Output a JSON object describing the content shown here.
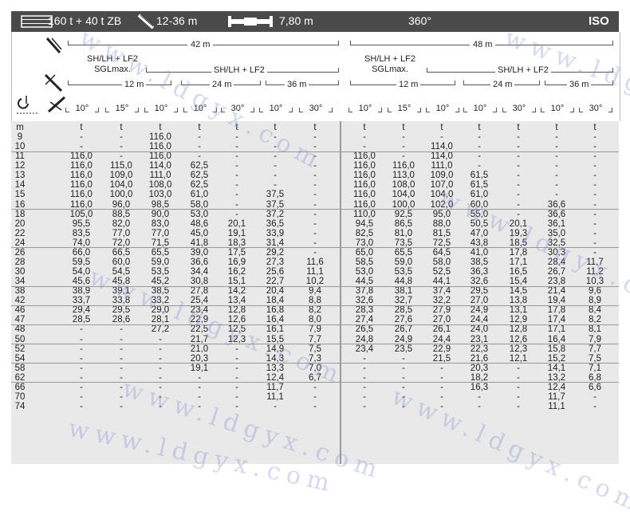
{
  "header": {
    "config": "160 t + 40 t ZB",
    "jib_range": "12-36 m",
    "outrigger": "7,80 m",
    "slew": "360°",
    "standard": "ISO"
  },
  "boom_group_left": {
    "boom": "42 m",
    "mode_a": "SH/LH + LF2",
    "mode_a_sub": "SGLmax.",
    "mode_b": "SH/LH + LF2",
    "jib_lengths": [
      "12 m",
      "24 m",
      "36 m"
    ],
    "offsets": [
      "10°",
      "15°",
      "10°",
      "10°",
      "30°",
      "10°",
      "30°"
    ]
  },
  "boom_group_right": {
    "boom": "48 m",
    "mode_a": "SH/LH + LF2",
    "mode_a_sub": "SGLmax.",
    "mode_b": "SH/LH + LF2",
    "jib_lengths": [
      "12 m",
      "24 m",
      "36 m"
    ],
    "offsets": [
      "10°",
      "15°",
      "10°",
      "10°",
      "30°",
      "10°",
      "30°"
    ]
  },
  "units": [
    "m",
    "t",
    "t",
    "t",
    "t",
    "t",
    "t",
    "t",
    "t",
    "t",
    "t",
    "t",
    "t",
    "t",
    "t"
  ],
  "rows": [
    [
      "9",
      "-",
      "-",
      "116,0",
      "-",
      "-",
      "-",
      "-",
      "-",
      "-",
      "-",
      "-",
      "-",
      "-",
      "-"
    ],
    [
      "10",
      "-",
      "-",
      "116,0",
      "-",
      "-",
      "-",
      "-",
      "-",
      "-",
      "114,0",
      "-",
      "-",
      "-",
      "-"
    ],
    [
      "11",
      "116,0",
      "-",
      "116,0",
      "-",
      "-",
      "-",
      "-",
      "116,0",
      "-",
      "114,0",
      "-",
      "-",
      "-",
      "-"
    ],
    [
      "12",
      "116,0",
      "115,0",
      "114,0",
      "62,5",
      "-",
      "-",
      "-",
      "116,0",
      "116,0",
      "111,0",
      "-",
      "-",
      "-",
      "-"
    ],
    [
      "13",
      "116,0",
      "109,0",
      "111,0",
      "62,5",
      "-",
      "-",
      "-",
      "116,0",
      "113,0",
      "109,0",
      "61,5",
      "-",
      "-",
      "-"
    ],
    [
      "14",
      "116,0",
      "104,0",
      "108,0",
      "62,5",
      "-",
      "-",
      "-",
      "116,0",
      "108,0",
      "107,0",
      "61,5",
      "-",
      "-",
      "-"
    ],
    [
      "15",
      "116,0",
      "100,0",
      "103,0",
      "61,0",
      "-",
      "37,5",
      "-",
      "116,0",
      "104,0",
      "104,0",
      "61,0",
      "-",
      "-",
      "-"
    ],
    [
      "16",
      "116,0",
      "96,0",
      "98,5",
      "58,0",
      "-",
      "37,5",
      "-",
      "116,0",
      "100,0",
      "102,0",
      "60,0",
      "-",
      "36,6",
      "-"
    ],
    [
      "18",
      "105,0",
      "88,5",
      "90,0",
      "53,0",
      "-",
      "37,2",
      "-",
      "110,0",
      "92,5",
      "95,0",
      "55,0",
      "-",
      "36,6",
      "-"
    ],
    [
      "20",
      "95,5",
      "82,0",
      "83,0",
      "48,6",
      "20,1",
      "36,5",
      "-",
      "94,5",
      "86,5",
      "88,0",
      "50,5",
      "20,1",
      "36,1",
      "-"
    ],
    [
      "22",
      "83,5",
      "77,0",
      "77,0",
      "45,0",
      "19,1",
      "33,9",
      "-",
      "82,5",
      "81,0",
      "81,5",
      "47,0",
      "19,3",
      "35,0",
      "-"
    ],
    [
      "24",
      "74,0",
      "72,0",
      "71,5",
      "41,8",
      "18,3",
      "31,4",
      "-",
      "73,0",
      "73,5",
      "72,5",
      "43,8",
      "18,5",
      "32,5",
      "-"
    ],
    [
      "26",
      "66,0",
      "66,5",
      "65,5",
      "39,0",
      "17,5",
      "29,2",
      "-",
      "65,0",
      "65,5",
      "64,5",
      "41,0",
      "17,8",
      "30,3",
      "-"
    ],
    [
      "28",
      "59,5",
      "60,0",
      "59,0",
      "36,6",
      "16,9",
      "27,3",
      "11,6",
      "58,5",
      "59,0",
      "58,0",
      "38,5",
      "17,1",
      "28,4",
      "11,7"
    ],
    [
      "30",
      "54,0",
      "54,5",
      "53,5",
      "34,4",
      "16,2",
      "25,6",
      "11,1",
      "53,0",
      "53,5",
      "52,5",
      "36,3",
      "16,5",
      "26,7",
      "11,2"
    ],
    [
      "34",
      "45,6",
      "45,8",
      "45,2",
      "30,8",
      "15,1",
      "22,7",
      "10,2",
      "44,5",
      "44,8",
      "44,1",
      "32,6",
      "15,4",
      "23,8",
      "10,3"
    ],
    [
      "38",
      "38,9",
      "39,1",
      "38,5",
      "27,8",
      "14,2",
      "20,4",
      "9,4",
      "37,8",
      "38,1",
      "37,4",
      "29,5",
      "14,5",
      "21,4",
      "9,6"
    ],
    [
      "42",
      "33,7",
      "33,8",
      "33,2",
      "25,4",
      "13,4",
      "18,4",
      "8,8",
      "32,6",
      "32,7",
      "32,2",
      "27,0",
      "13,8",
      "19,4",
      "8,9"
    ],
    [
      "46",
      "29,4",
      "29,5",
      "29,0",
      "23,4",
      "12,8",
      "16,8",
      "8,2",
      "28,3",
      "28,5",
      "27,9",
      "24,9",
      "13,1",
      "17,8",
      "8,4"
    ],
    [
      "47",
      "28,5",
      "28,6",
      "28,1",
      "22,9",
      "12,6",
      "16,4",
      "8,0",
      "27,4",
      "27,6",
      "27,0",
      "24,4",
      "12,9",
      "17,4",
      "8,2"
    ],
    [
      "48",
      "-",
      "-",
      "27,2",
      "22,5",
      "12,5",
      "16,1",
      "7,9",
      "26,5",
      "26,7",
      "26,1",
      "24,0",
      "12,8",
      "17,1",
      "8,1"
    ],
    [
      "50",
      "-",
      "-",
      "-",
      "21,7",
      "12,3",
      "15,5",
      "7,7",
      "24,8",
      "24,9",
      "24,4",
      "23,1",
      "12,6",
      "16,4",
      "7,9"
    ],
    [
      "52",
      "-",
      "-",
      "-",
      "21,0",
      "-",
      "14,9",
      "7,5",
      "23,4",
      "23,5",
      "22,9",
      "22,3",
      "12,3",
      "15,8",
      "7,7"
    ],
    [
      "54",
      "-",
      "-",
      "-",
      "20,3",
      "-",
      "14,3",
      "7,3",
      "-",
      "-",
      "21,5",
      "21,6",
      "12,1",
      "15,2",
      "7,5"
    ],
    [
      "58",
      "-",
      "-",
      "-",
      "19,1",
      "-",
      "13,3",
      "7,0",
      "-",
      "-",
      "-",
      "20,3",
      "-",
      "14,1",
      "7,1"
    ],
    [
      "62",
      "-",
      "-",
      "-",
      "-",
      "-",
      "12,4",
      "6,7",
      "-",
      "-",
      "-",
      "18,2",
      "-",
      "13,2",
      "6,8"
    ],
    [
      "66",
      "-",
      "-",
      "-",
      "-",
      "-",
      "11,7",
      "-",
      "-",
      "-",
      "-",
      "16,3",
      "-",
      "12,4",
      "6,6"
    ],
    [
      "70",
      "-",
      "-",
      "-",
      "-",
      "-",
      "11,1",
      "-",
      "-",
      "-",
      "-",
      "-",
      "-",
      "11,7",
      "-"
    ],
    [
      "74",
      "-",
      "-",
      "-",
      "-",
      "-",
      "-",
      "-",
      "-",
      "-",
      "-",
      "-",
      "-",
      "11,1",
      "-"
    ]
  ],
  "watermark": "www.ldgyx.com",
  "colors": {
    "header_bg": "#4a4a4a",
    "table_bg": "#e9e9e9"
  }
}
